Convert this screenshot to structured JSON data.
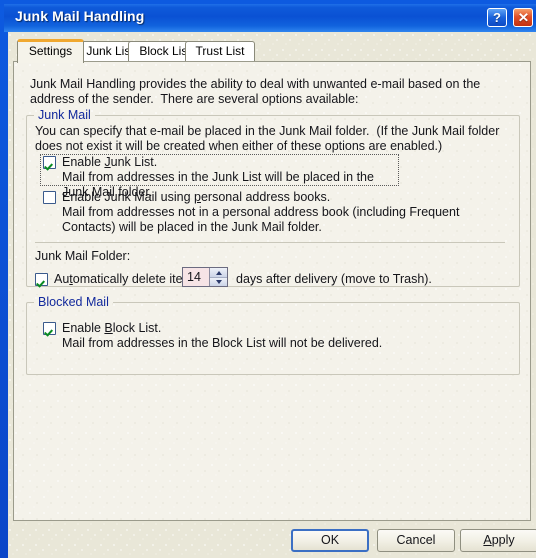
{
  "window": {
    "title": "Junk Mail Handling",
    "help_button": "?",
    "close_button": "✕"
  },
  "tabs": [
    {
      "label": "Settings",
      "active": true
    },
    {
      "label": "Junk List",
      "active": false
    },
    {
      "label": "Block List",
      "active": false
    },
    {
      "label": "Trust List",
      "active": false
    }
  ],
  "settings": {
    "intro": "Junk Mail Handling provides the ability to deal with unwanted e-mail based on the address of the sender.  There are several options available:",
    "junk_mail_group": {
      "legend": "Junk Mail",
      "description": "You can specify that e-mail be placed in the Junk Mail folder.  (If the Junk Mail folder does not exist it will be created when either of these options are enabled.)",
      "enable_junk_list": {
        "label": "Enable Junk List.",
        "accel": "J",
        "sublabel": "Mail from addresses in the Junk List will be placed in the Junk Mail folder.",
        "checked": true,
        "focused": true
      },
      "enable_personal_address_books": {
        "label": "Enable Junk Mail using personal address books.",
        "accel": "p",
        "sublabel": "Mail from addresses not in a personal address book (including Frequent Contacts) will be placed in the Junk Mail folder.",
        "checked": false,
        "focused": false
      },
      "folder_label": "Junk Mail Folder:",
      "auto_delete": {
        "label": "Automatically delete items",
        "accel": "t",
        "checked": true,
        "value": "14",
        "suffix": "days after delivery (move to Trash)."
      }
    },
    "blocked_mail_group": {
      "legend": "Blocked Mail",
      "enable_block_list": {
        "label": "Enable Block List.",
        "accel": "B",
        "sublabel": "Mail from addresses in the Block List will not be delivered.",
        "checked": true
      }
    }
  },
  "buttons": {
    "ok": "OK",
    "cancel": "Cancel",
    "apply": "Apply",
    "apply_accel": "A"
  },
  "colors": {
    "titlebar_blue": "#0a51d4",
    "active_tab_accent": "#f0a830",
    "group_legend": "#12299c",
    "check_green": "#0a8b22",
    "close_red": "#e2512a",
    "panel_bg": "#f4f2ea",
    "client_bg": "#e9e7d8"
  }
}
